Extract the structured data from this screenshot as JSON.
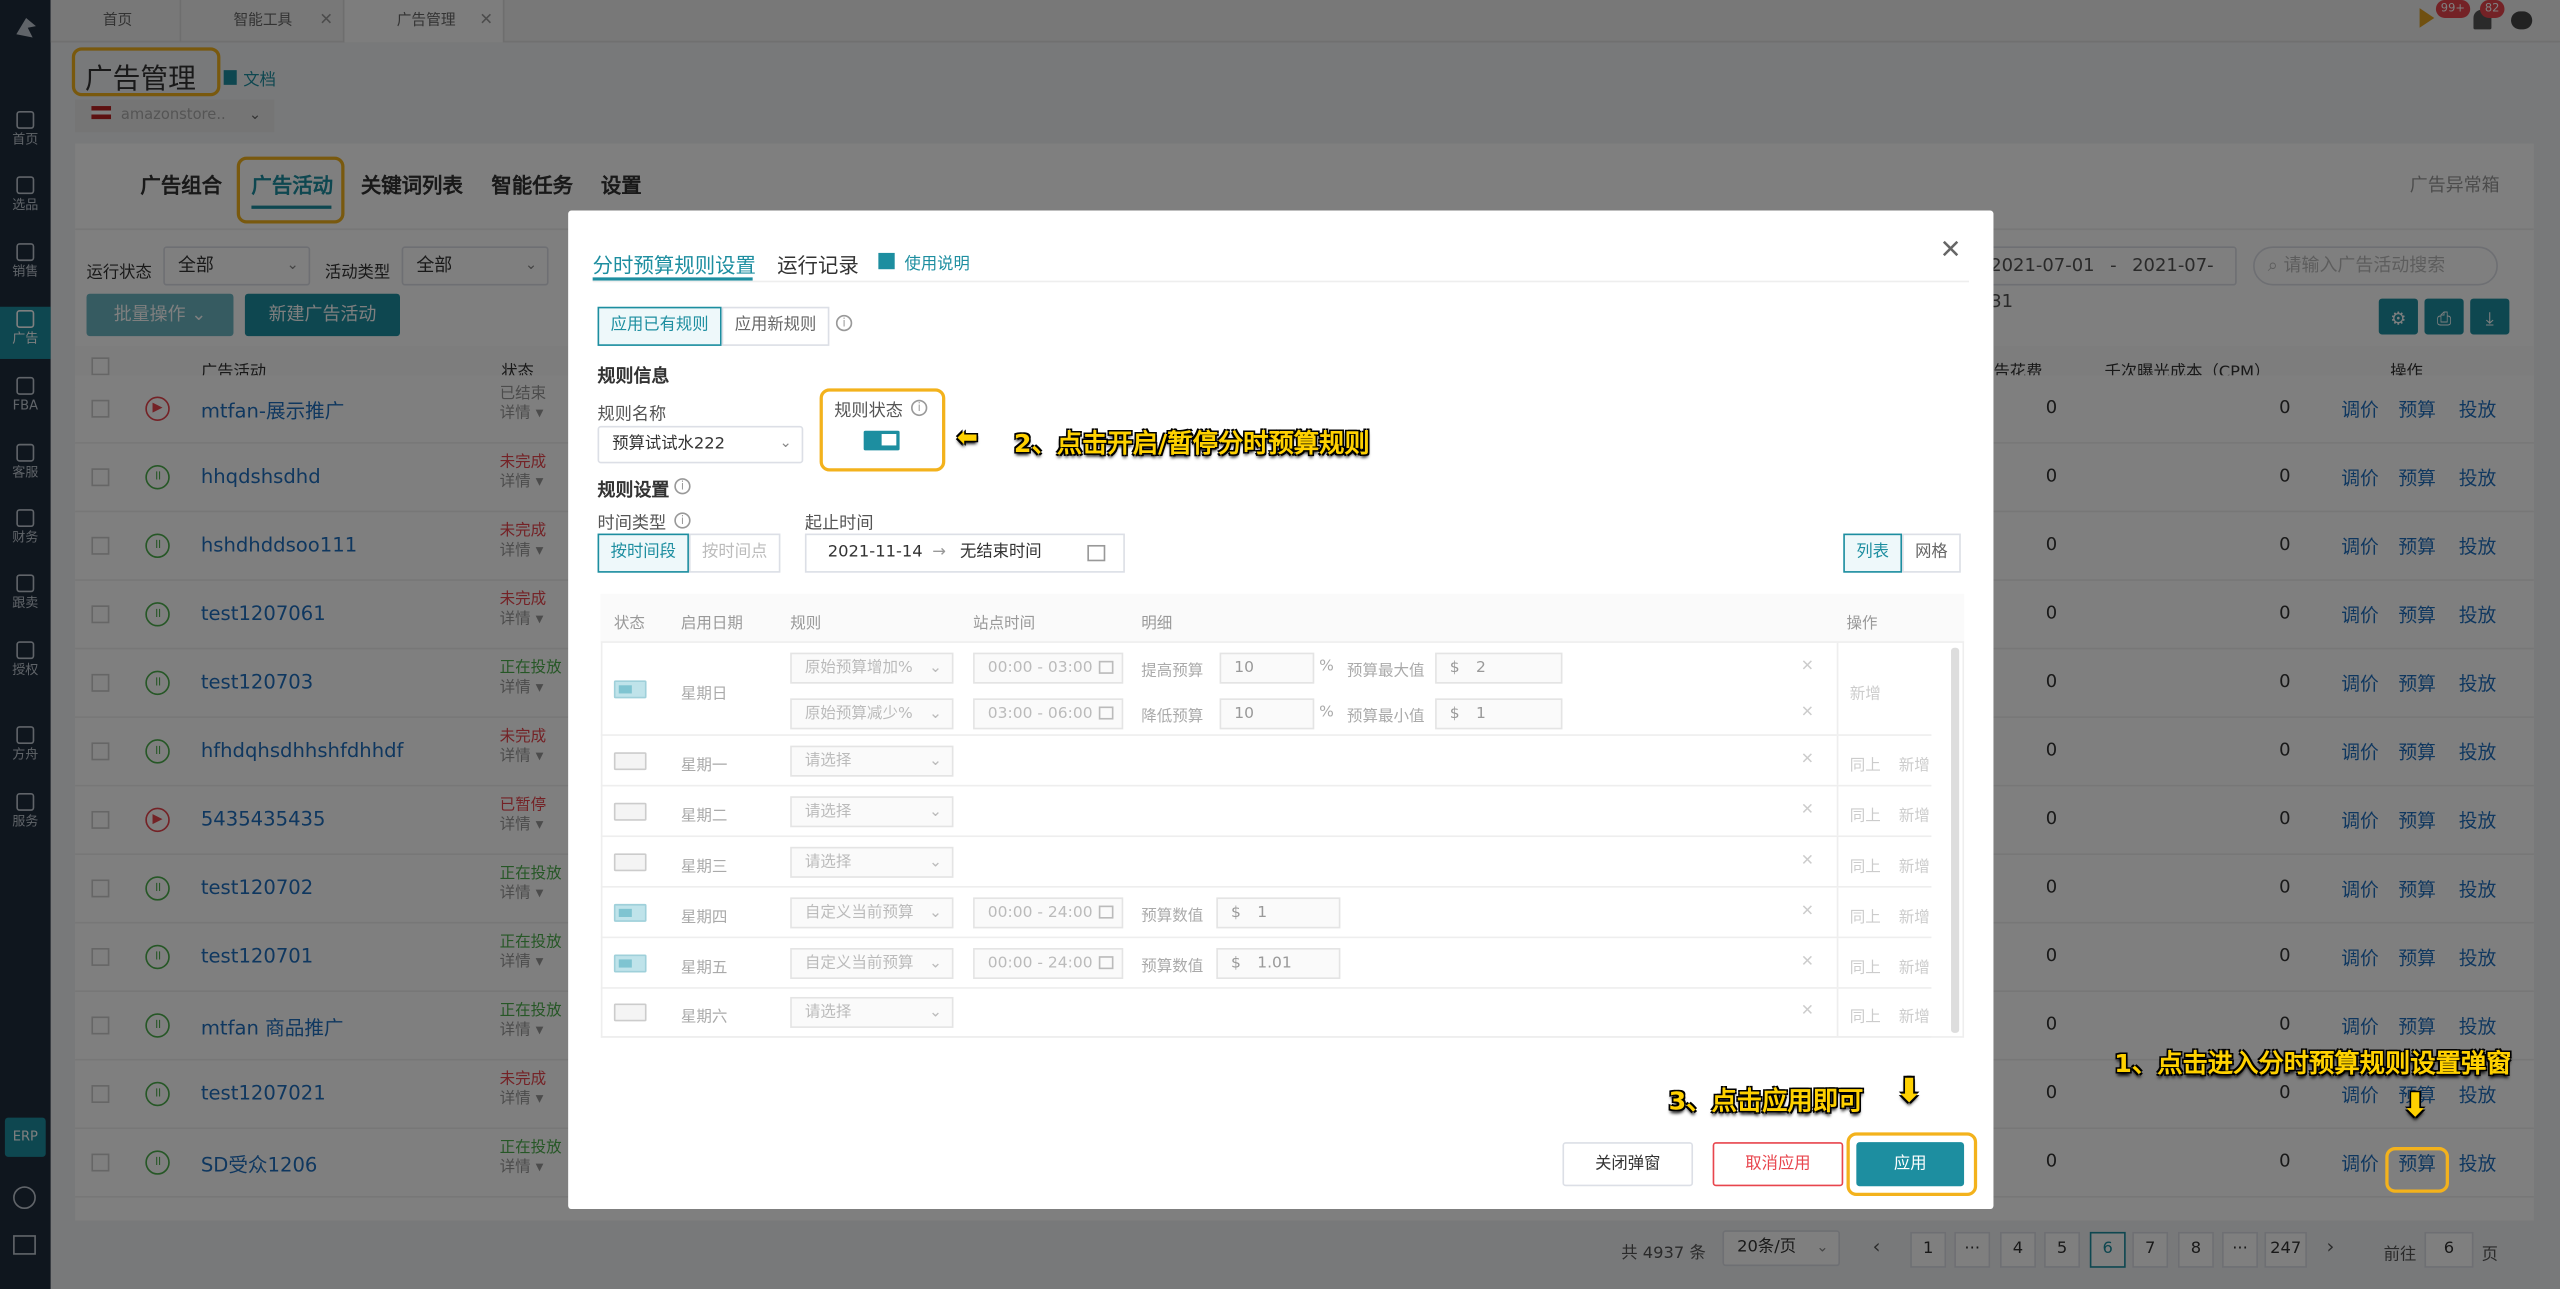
{
  "sidebar": {
    "items": [
      {
        "icon": "home-icon",
        "label": "首页"
      },
      {
        "icon": "search-icon",
        "label": "选品"
      },
      {
        "icon": "chart-icon",
        "label": "销售"
      },
      {
        "icon": "ad-icon",
        "label": "广告"
      },
      {
        "icon": "fba-icon",
        "label": "FBA"
      },
      {
        "icon": "service-icon",
        "label": "客服"
      },
      {
        "icon": "finance-icon",
        "label": "财务"
      },
      {
        "icon": "track-icon",
        "label": "跟卖"
      },
      {
        "icon": "auth-icon",
        "label": "授权"
      },
      {
        "icon": "boat-icon",
        "label": "方舟"
      },
      {
        "icon": "building-icon",
        "label": "服务"
      }
    ],
    "erp": "ERP"
  },
  "tabs": [
    {
      "label": "首页"
    },
    {
      "label": "智能工具"
    },
    {
      "label": "广告管理"
    }
  ],
  "header": {
    "badge1": "99+",
    "badge2": "82",
    "title": "广告管理",
    "doc": "文档",
    "account": "amazonstore.."
  },
  "nav": {
    "tabs": [
      "广告组合",
      "广告活动",
      "关键词列表",
      "智能任务",
      "设置"
    ],
    "right": "广告异常箱"
  },
  "filters": {
    "run_status_label": "运行状态",
    "run_status": "全部",
    "type_label": "活动类型",
    "type": "全部",
    "date_start": "2021-07-01",
    "date_sep": "-",
    "date_end": "2021-07-31",
    "search_placeholder": "请输入广告活动搜索",
    "batch": "批量操作",
    "new": "新建广告活动"
  },
  "table": {
    "headers": [
      "广告活动",
      "状态",
      "告花费",
      "千次曝光成本（CPM）",
      "操作"
    ],
    "op_labels": [
      "调价",
      "预算",
      "投放"
    ],
    "detail": "详情",
    "rows": [
      {
        "name": "mtfan-展示推广",
        "status": "已结束",
        "icon": "play",
        "color": "#999",
        "spend": "0",
        "cpm": "0"
      },
      {
        "name": "hhqdshsdhd",
        "status": "未完成",
        "icon": "pause",
        "color": "#e8454d",
        "spend": "0",
        "cpm": "0"
      },
      {
        "name": "hshdhddsoo111",
        "status": "未完成",
        "icon": "pause",
        "color": "#e8454d",
        "spend": "0",
        "cpm": "0"
      },
      {
        "name": "test1207061",
        "status": "未完成",
        "icon": "pause",
        "color": "#e8454d",
        "spend": "0",
        "cpm": "0"
      },
      {
        "name": "test120703",
        "status": "正在投放",
        "icon": "pause",
        "color": "#4cae4c",
        "spend": "0",
        "cpm": "0"
      },
      {
        "name": "hfhdqhsdhhshfdhhdf",
        "status": "未完成",
        "icon": "pause",
        "color": "#e8454d",
        "spend": "0",
        "cpm": "0"
      },
      {
        "name": "5435435435",
        "status": "已暂停",
        "icon": "play",
        "color": "#e8454d",
        "spend": "0",
        "cpm": "0"
      },
      {
        "name": "test120702",
        "status": "正在投放",
        "icon": "pause",
        "color": "#4cae4c",
        "spend": "0",
        "cpm": "0"
      },
      {
        "name": "test120701",
        "status": "正在投放",
        "icon": "pause",
        "color": "#4cae4c",
        "spend": "0",
        "cpm": "0"
      },
      {
        "name": "mtfan 商品推广",
        "status": "正在投放",
        "icon": "pause",
        "color": "#4cae4c",
        "spend": "0",
        "cpm": "0"
      },
      {
        "name": "test1207021",
        "status": "未完成",
        "icon": "pause",
        "color": "#e8454d",
        "spend": "0",
        "cpm": "0"
      },
      {
        "name": "SD受众1206",
        "status": "正在投放",
        "icon": "pause",
        "color": "#4cae4c",
        "spend": "0",
        "cpm": "0"
      }
    ]
  },
  "pagination": {
    "total": "共 4937 条",
    "size": "20条/页",
    "pages": [
      "1",
      "4",
      "5",
      "6",
      "7",
      "8",
      "247"
    ],
    "ellipsis": "···",
    "current": "6",
    "goto": "前往",
    "goto_val": "6",
    "page_unit": "页"
  },
  "modal": {
    "tab1": "分时预算规则设置",
    "tab2": "运行记录",
    "help": "使用说明",
    "mode_existing": "应用已有规则",
    "mode_new": "应用新规则",
    "section_info": "规则信息",
    "rule_name_label": "规则名称",
    "rule_name": "预算试试水222",
    "rule_status_label": "规则状态",
    "section_settings": "规则设置",
    "time_type_label": "时间类型",
    "time_period": "按时间段",
    "time_point": "按时间点",
    "range_label": "起止时间",
    "range_start": "2021-11-14",
    "range_arrow": "→",
    "range_end": "无结束时间",
    "view_list": "列表",
    "view_grid": "网格",
    "grid_headers": [
      "状态",
      "启用日期",
      "规则",
      "站点时间",
      "明细",
      "操作"
    ],
    "days": [
      {
        "day": "星期日",
        "on": true,
        "rules": [
          {
            "rule": "原始预算增加%",
            "time": "00:00 - 03:00",
            "detail_label": "提高预算",
            "detail_val": "10",
            "unit": "%",
            "limit_label": "预算最大值",
            "cur": "$",
            "limit_val": "2"
          },
          {
            "rule": "原始预算减少%",
            "time": "03:00 - 06:00",
            "detail_label": "降低预算",
            "detail_val": "10",
            "unit": "%",
            "limit_label": "预算最小值",
            "cur": "$",
            "limit_val": "1"
          }
        ],
        "op": [
          "新增"
        ]
      },
      {
        "day": "星期一",
        "on": false,
        "rules": [
          {
            "rule": "请选择"
          }
        ],
        "op": [
          "同上",
          "新增"
        ]
      },
      {
        "day": "星期二",
        "on": false,
        "rules": [
          {
            "rule": "请选择"
          }
        ],
        "op": [
          "同上",
          "新增"
        ]
      },
      {
        "day": "星期三",
        "on": false,
        "rules": [
          {
            "rule": "请选择"
          }
        ],
        "op": [
          "同上",
          "新增"
        ]
      },
      {
        "day": "星期四",
        "on": true,
        "rules": [
          {
            "rule": "自定义当前预算",
            "time": "00:00 - 24:00",
            "detail_label": "预算数值",
            "cur": "$",
            "detail_val": "1"
          }
        ],
        "op": [
          "同上",
          "新增"
        ]
      },
      {
        "day": "星期五",
        "on": true,
        "rules": [
          {
            "rule": "自定义当前预算",
            "time": "00:00 - 24:00",
            "detail_label": "预算数值",
            "cur": "$",
            "detail_val": "1.01"
          }
        ],
        "op": [
          "同上",
          "新增"
        ]
      },
      {
        "day": "星期六",
        "on": false,
        "rules": [
          {
            "rule": "请选择"
          }
        ],
        "op": [
          "同上",
          "新增"
        ]
      }
    ],
    "close": "关闭弹窗",
    "cancel": "取消应用",
    "apply": "应用"
  },
  "annotations": {
    "step1": "1、点击进入分时预算规则设置弹窗",
    "step2": "2、点击开启/暂停分时预算规则",
    "step3": "3、点击应用即可"
  },
  "colors": {
    "accent": "#1d8ea0",
    "highlight": "#f3b21c",
    "annotation": "#ffd100",
    "danger": "#e8454d",
    "success": "#4cae4c"
  }
}
